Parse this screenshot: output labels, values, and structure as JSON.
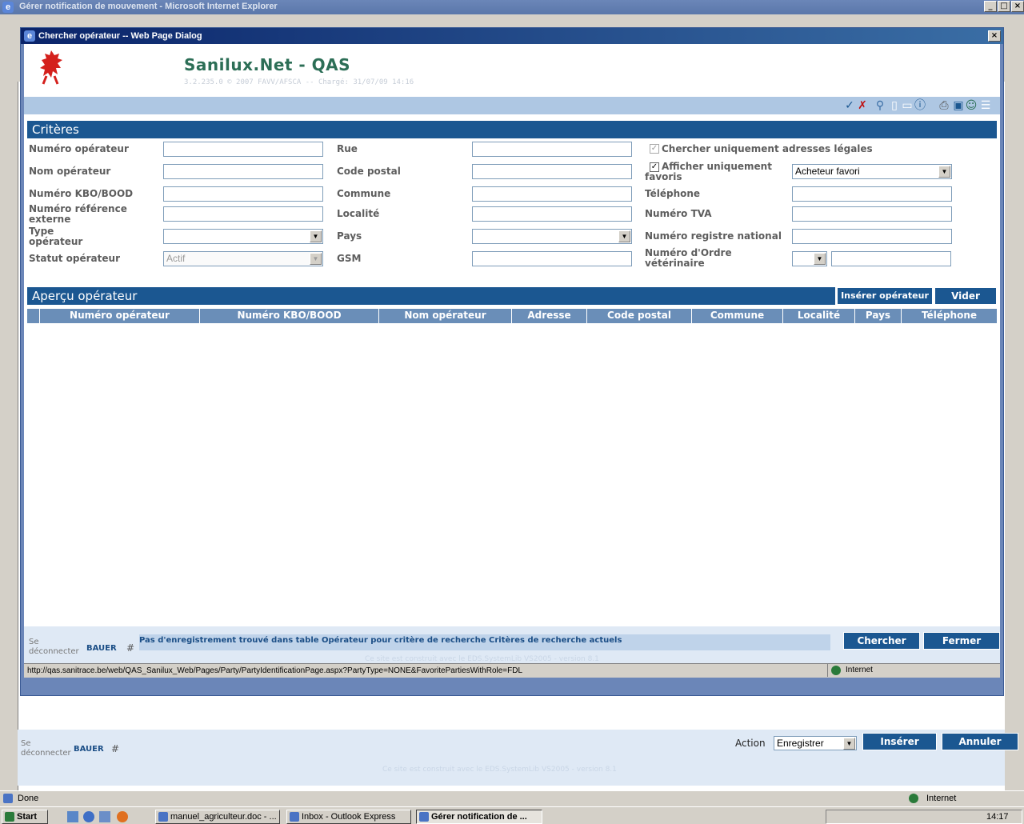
{
  "browser": {
    "title": "Gérer notification de mouvement - Microsoft Internet Explorer",
    "status_text": "Done",
    "zone": "Internet",
    "page_footer": {
      "logout": "Se déconnecter",
      "user": "BAUER",
      "hash": "#",
      "action_label": "Action",
      "action_value": "Enregistrer",
      "insert_button": "Insérer",
      "cancel_button": "Annuler",
      "credit": "Ce site est construit avec le EDS.SystemLib VS2005 - version 8.1"
    }
  },
  "dialog": {
    "title": "Chercher opérateur -- Web Page Dialog",
    "app_title": "Sanilux.Net - QAS",
    "app_version": "3.2.235.0 © 2007 FAVV/AFSCA -- Chargé: 31/07/09 14:16",
    "criteria": {
      "header": "Critères",
      "numero_operateur": "Numéro opérateur",
      "nom_operateur": "Nom opérateur",
      "numero_kbo": "Numéro KBO/BOOD",
      "numero_ref_externe": "Numéro référence externe",
      "type_operateur": "Type opérateur",
      "statut_operateur": "Statut opérateur",
      "statut_value": "Actif",
      "rue": "Rue",
      "code_postal": "Code postal",
      "commune": "Commune",
      "localite": "Localité",
      "pays": "Pays",
      "gsm": "GSM",
      "legal_only": "Chercher uniquement adresses légales",
      "favoris_only": "Afficher uniquement favoris",
      "favori_value": "Acheteur favori",
      "telephone": "Téléphone",
      "numero_tva": "Numéro TVA",
      "registre_national": "Numéro registre national",
      "ordre_veterinaire": "Numéro d'Ordre vétérinaire"
    },
    "overview": {
      "header": "Aperçu opérateur",
      "insert_button": "Insérer opérateur",
      "clear_button": "Vider",
      "columns": [
        "Numéro opérateur",
        "Numéro KBO/BOOD",
        "Nom opérateur",
        "Adresse",
        "Code postal",
        "Commune",
        "Localité",
        "Pays",
        "Téléphone"
      ]
    },
    "footer": {
      "logout": "Se déconnecter",
      "user": "BAUER",
      "hash": "#",
      "message": "Pas d'enregistrement trouvé dans table Opérateur pour critère de recherche Critères de recherche actuels",
      "search_button": "Chercher",
      "close_button": "Fermer",
      "credit": "Ce site est construit avec le EDS.SystemLib VS2005 - version 8.1"
    },
    "status_url": "http://qas.sanitrace.be/web/QAS_Sanilux_Web/Pages/Party/PartyIdentificationPage.aspx?PartyType=NONE&FavoritePartiesWithRole=FDL",
    "status_zone": "Internet"
  },
  "taskbar": {
    "start": "Start",
    "items": [
      "manuel_agriculteur.doc - ...",
      "Inbox - Outlook Express",
      "Gérer notification de ..."
    ],
    "clock": "14:17"
  }
}
